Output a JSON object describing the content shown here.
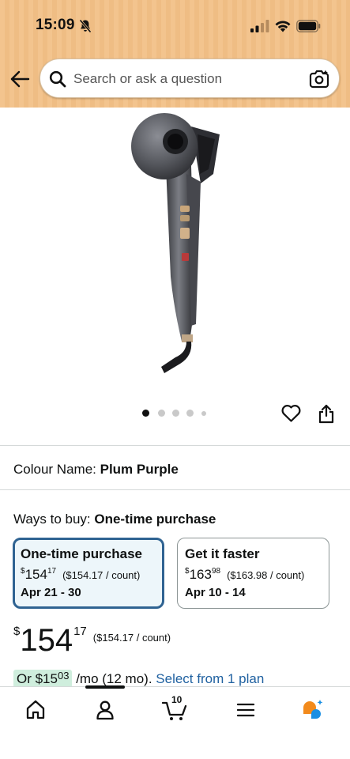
{
  "status_bar": {
    "time": "15:09"
  },
  "search": {
    "placeholder": "Search or ask a question"
  },
  "product": {
    "image_count": 5,
    "active_image_index": 0,
    "colour_label": "Colour Name:",
    "colour_value": "Plum Purple"
  },
  "ways_to_buy": {
    "label": "Ways to buy:",
    "selected": "One-time purchase",
    "options": [
      {
        "title": "One-time purchase",
        "price_symbol": "$",
        "price_whole": "154",
        "price_fraction": "17",
        "unit_price": "($154.17 / count)",
        "dates": "Apr 21 - 30"
      },
      {
        "title": "Get it faster",
        "price_symbol": "$",
        "price_whole": "163",
        "price_fraction": "98",
        "unit_price": "($163.98 / count)",
        "dates": "Apr 10 - 14"
      }
    ]
  },
  "price": {
    "symbol": "$",
    "whole": "154",
    "fraction": "17",
    "unit_price": "($154.17 / count)"
  },
  "installment": {
    "prefix": "Or $15",
    "fraction": "03",
    "suffix": "/mo (12 mo).",
    "link": "Select from 1 plan"
  },
  "bottom_nav": {
    "cart_count": "10"
  },
  "colors": {
    "header_bg": "#f3c48e",
    "selected_border": "#2f6392",
    "selected_bg": "#edf6fa",
    "link": "#2162a1",
    "installment_pill": "#cfeedd",
    "assistant_orange": "#f28a1c",
    "assistant_blue": "#1a8fe3"
  }
}
